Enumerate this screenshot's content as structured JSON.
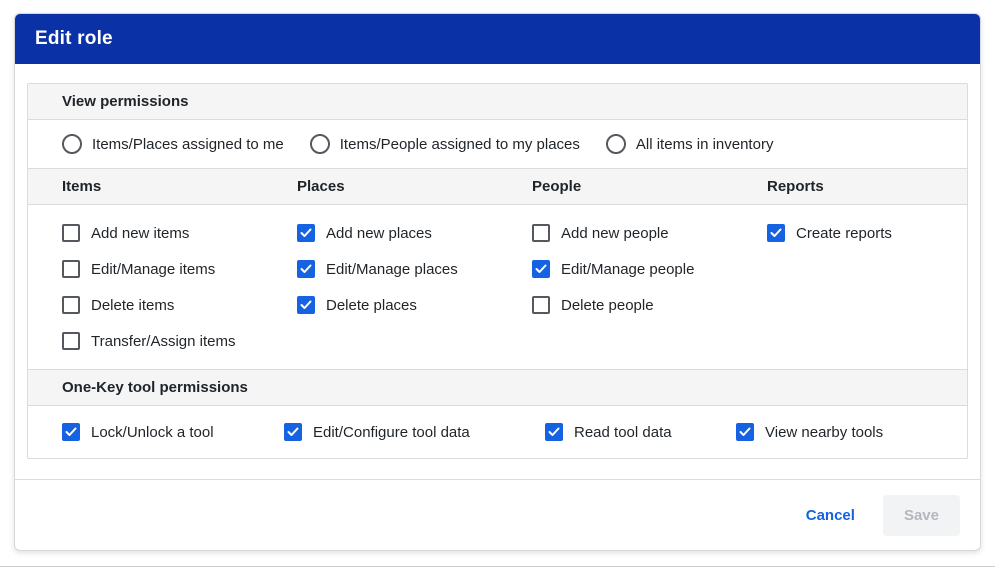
{
  "modal": {
    "title": "Edit role",
    "view_permissions": {
      "heading": "View permissions",
      "options": [
        {
          "label": "Items/Places assigned to me",
          "selected": false
        },
        {
          "label": "Items/People assigned to my places",
          "selected": false
        },
        {
          "label": "All items in inventory",
          "selected": false
        }
      ]
    },
    "permission_columns": [
      {
        "header": "Items",
        "items": [
          {
            "label": "Add new items",
            "checked": false
          },
          {
            "label": "Edit/Manage items",
            "checked": false
          },
          {
            "label": "Delete items",
            "checked": false
          },
          {
            "label": "Transfer/Assign items",
            "checked": false
          }
        ]
      },
      {
        "header": "Places",
        "items": [
          {
            "label": "Add new places",
            "checked": true
          },
          {
            "label": "Edit/Manage places",
            "checked": true
          },
          {
            "label": "Delete places",
            "checked": true
          }
        ]
      },
      {
        "header": "People",
        "items": [
          {
            "label": "Add new people",
            "checked": false
          },
          {
            "label": "Edit/Manage people",
            "checked": true
          },
          {
            "label": "Delete people",
            "checked": false
          }
        ]
      },
      {
        "header": "Reports",
        "items": [
          {
            "label": "Create reports",
            "checked": true
          }
        ]
      }
    ],
    "one_key": {
      "heading": "One-Key tool permissions",
      "items": [
        {
          "label": "Lock/Unlock a tool",
          "checked": true
        },
        {
          "label": "Edit/Configure tool data",
          "checked": true
        },
        {
          "label": "Read tool data",
          "checked": true
        },
        {
          "label": "View nearby tools",
          "checked": true
        }
      ]
    },
    "footer": {
      "cancel_label": "Cancel",
      "save_label": "Save",
      "save_enabled": false
    }
  },
  "colors": {
    "header_blue": "#0a31a6",
    "accent_blue": "#1563e2",
    "section_gray": "#f5f5f6",
    "border_gray": "#d8dbdf"
  }
}
